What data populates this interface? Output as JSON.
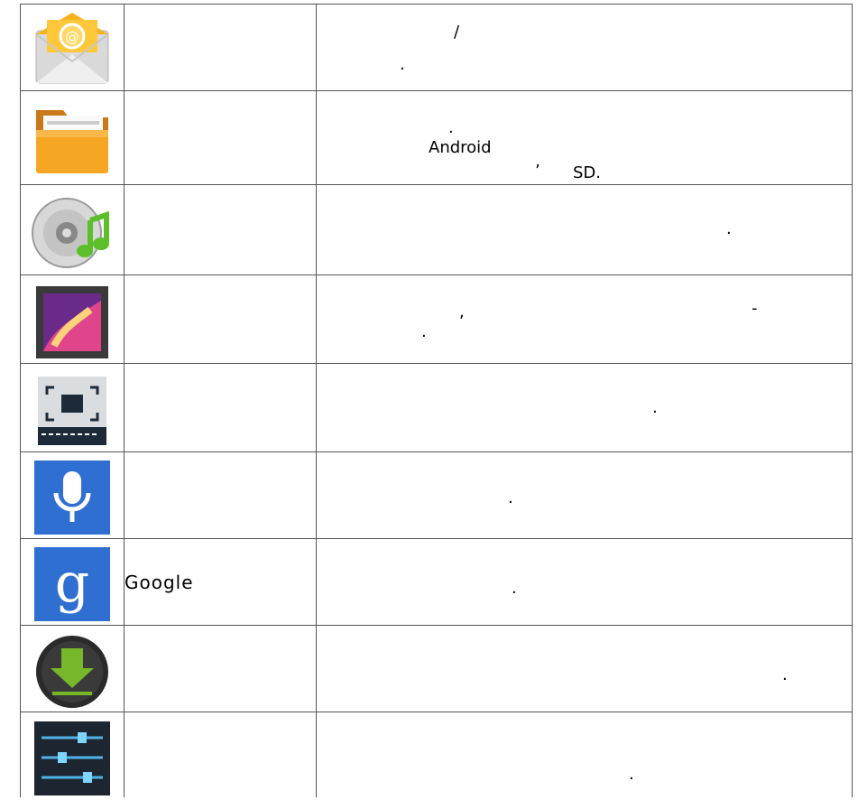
{
  "rows": [
    {
      "icon": "email-icon",
      "name": "",
      "desc_marks": [
        "/",
        "."
      ]
    },
    {
      "icon": "folder-icon",
      "name": "",
      "desc_marks": [
        ".",
        "Android",
        "’",
        "SD."
      ]
    },
    {
      "icon": "music-disc-icon",
      "name": "",
      "desc_marks": [
        "."
      ]
    },
    {
      "icon": "gallery-icon",
      "name": "",
      "desc_marks": [
        ",",
        "-",
        "."
      ]
    },
    {
      "icon": "screenshot-icon",
      "name": "",
      "desc_marks": [
        "."
      ]
    },
    {
      "icon": "microphone-icon",
      "name": "",
      "desc_marks": [
        "."
      ]
    },
    {
      "icon": "google-search-icon",
      "name": "Google",
      "desc_marks": [
        "."
      ]
    },
    {
      "icon": "download-icon",
      "name": "",
      "desc_marks": [
        "."
      ]
    },
    {
      "icon": "settings-sliders-icon",
      "name": "",
      "desc_marks": [
        "."
      ]
    }
  ]
}
